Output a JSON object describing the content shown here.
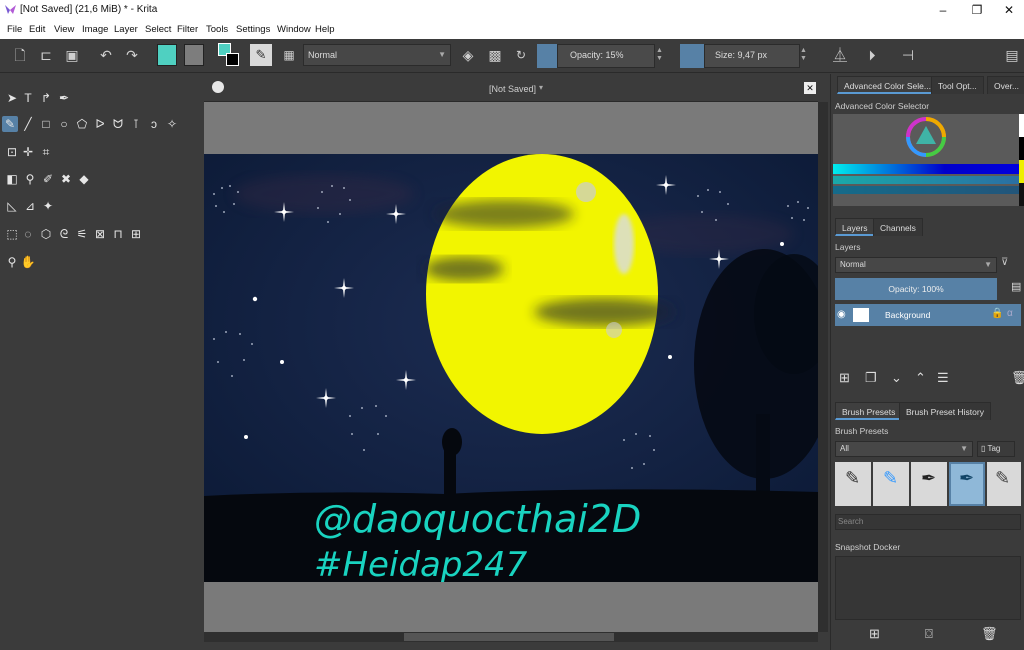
{
  "window": {
    "title": "[Not Saved]  (21,6 MiB)  * - Krita",
    "min": "–",
    "max": "❐",
    "close": "✕"
  },
  "menu": [
    "File",
    "Edit",
    "View",
    "Image",
    "Layer",
    "Select",
    "Filter",
    "Tools",
    "Settings",
    "Window",
    "Help"
  ],
  "toolbar": {
    "blend_mode": "Normal",
    "opacity": "Opacity: 15%",
    "size": "Size: 9,47 px"
  },
  "document": {
    "tab_title": "[Not Saved]",
    "text_line1": "@daoquocthai2D",
    "text_line2": "#Heidap247"
  },
  "docker": {
    "tabs_top": [
      "Advanced Color Sele...",
      "Tool Opt...",
      "Over..."
    ],
    "color_selector_label": "Advanced Color Selector",
    "layer_tabs": [
      "Layers",
      "Channels"
    ],
    "layers_label": "Layers",
    "layer_blend": "Normal",
    "layer_opacity": "Opacity: 100%",
    "layer_name": "Background",
    "brush_tabs": [
      "Brush Presets",
      "Brush Preset History"
    ],
    "brush_label": "Brush Presets",
    "brush_filter": "All",
    "brush_tag": "Tag",
    "search_placeholder": "Search",
    "snapshot_label": "Snapshot Docker"
  },
  "colors": {
    "accent": "#5781a6",
    "moon": "#f2f500",
    "sky": "#0f1e3d",
    "text_teal": "#19d3c0"
  }
}
